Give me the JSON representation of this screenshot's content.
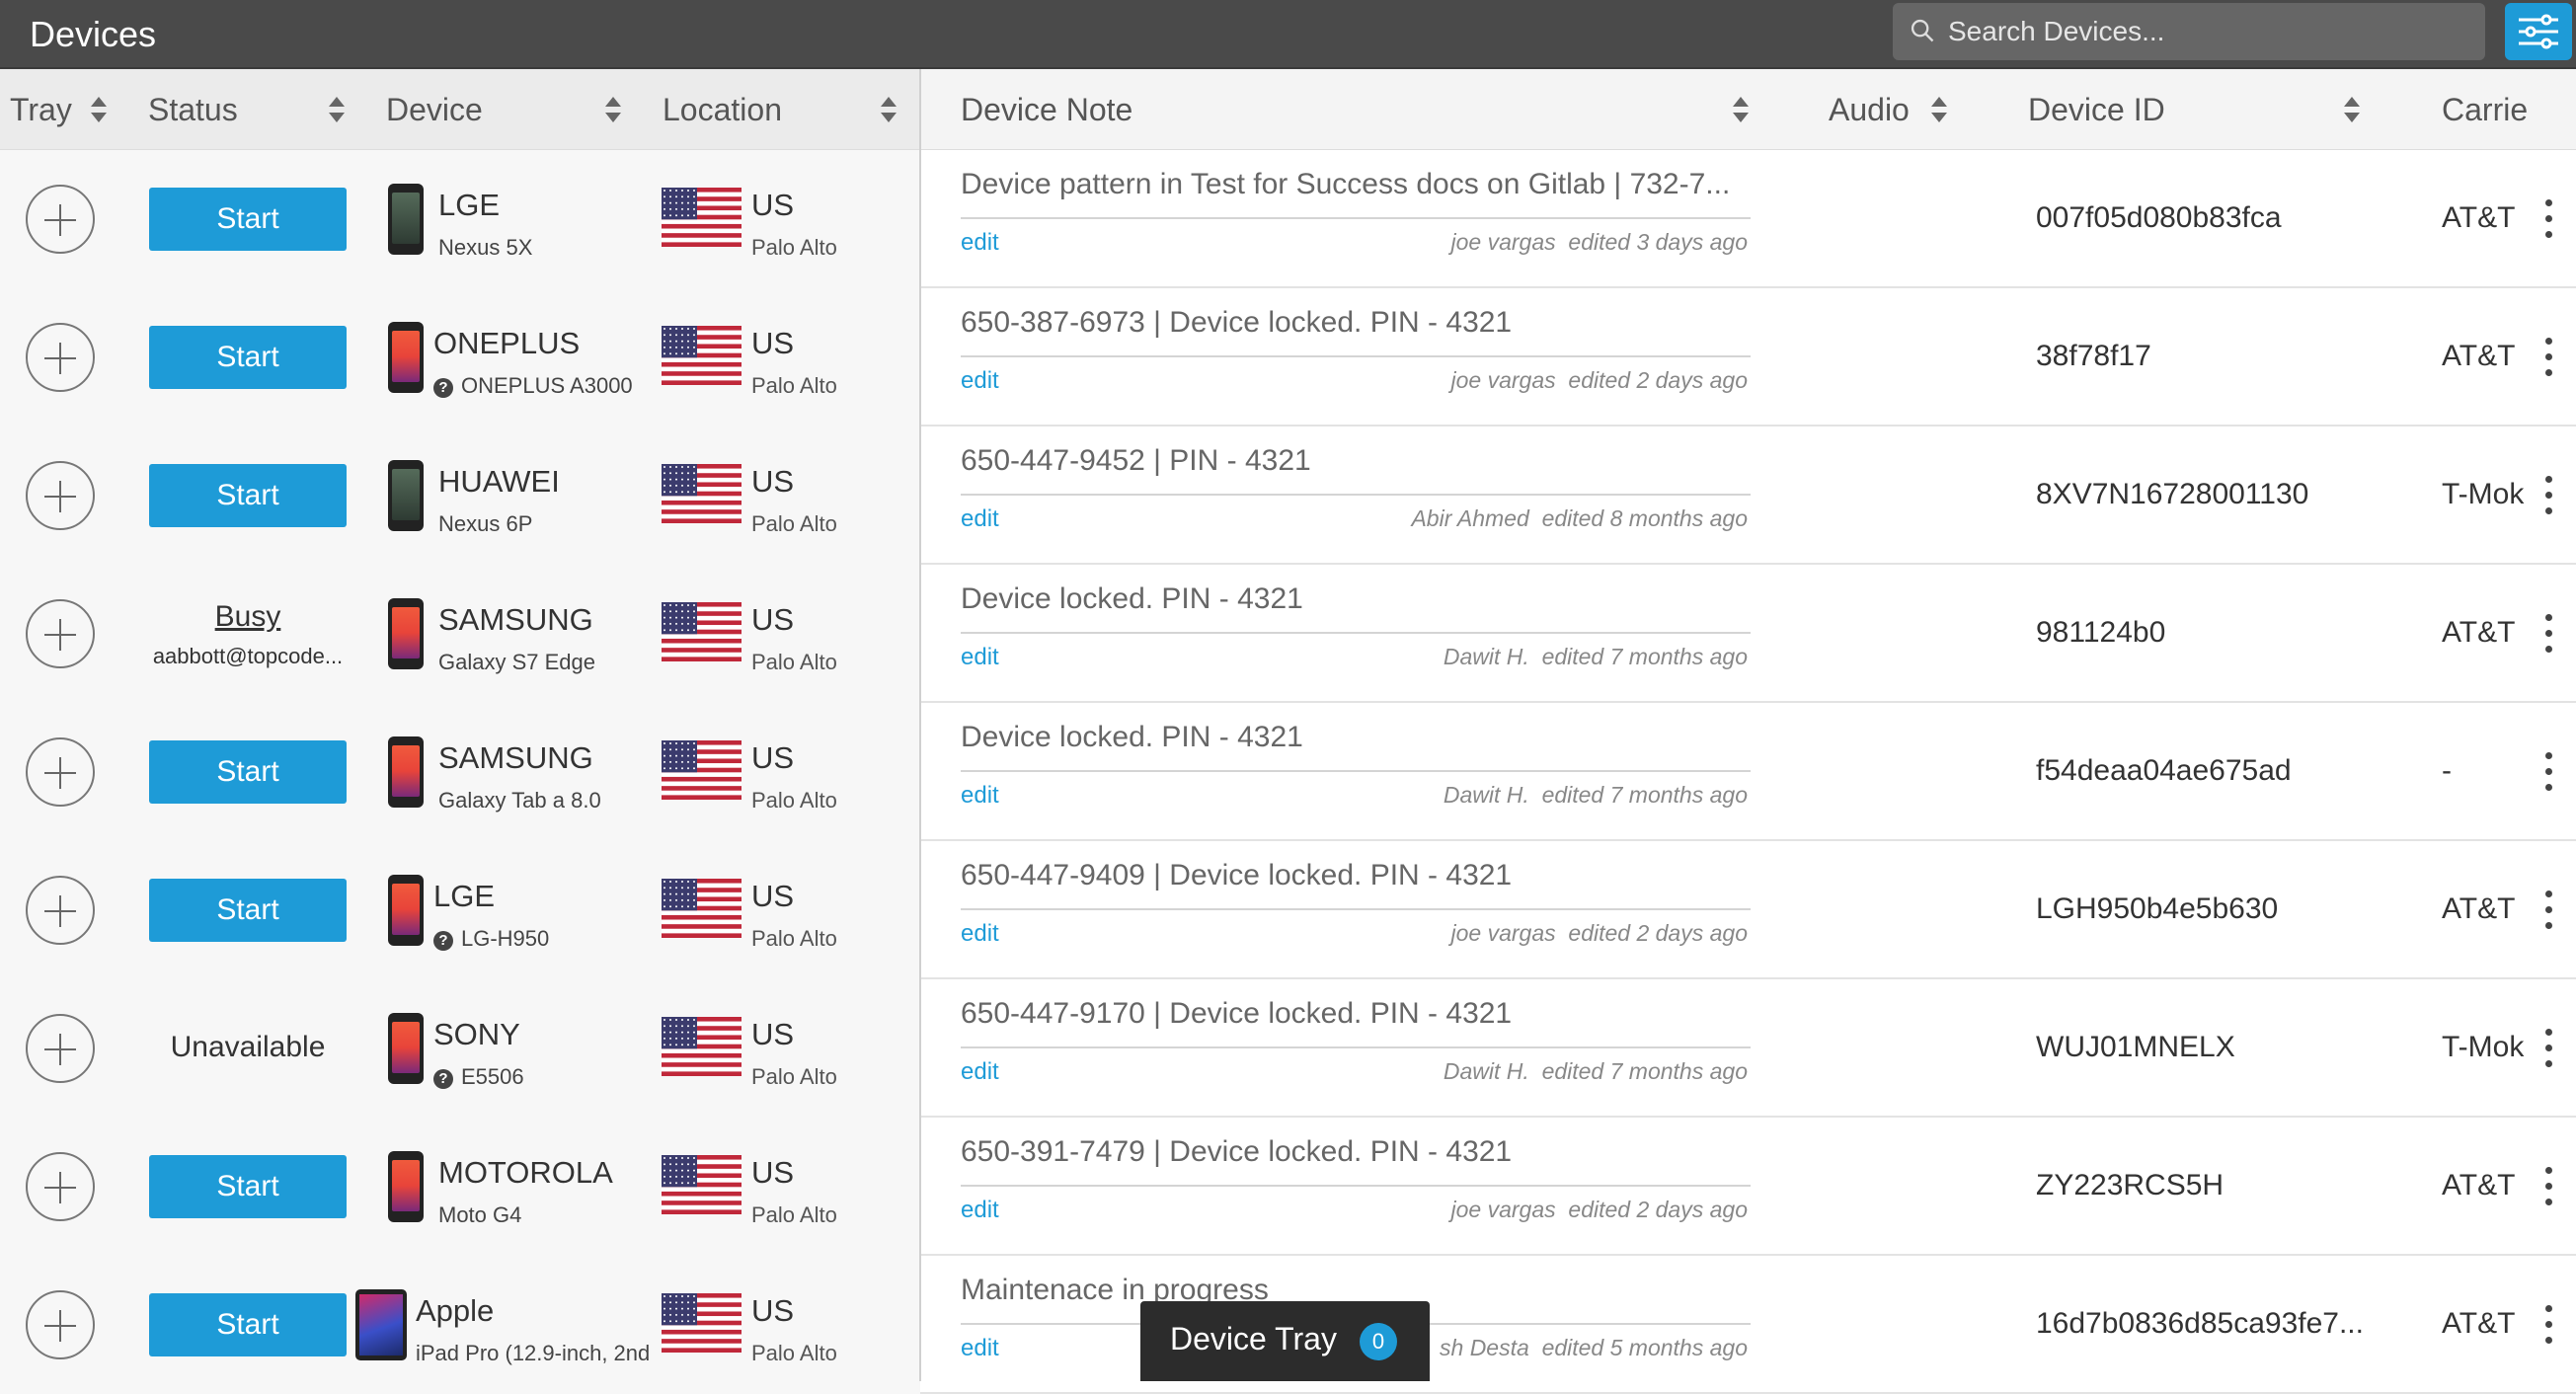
{
  "app": {
    "title": "Devices",
    "search_placeholder": "Search Devices...",
    "accent_color": "#1e9bd7"
  },
  "columns": {
    "tray": "Tray",
    "status": "Status",
    "device": "Device",
    "location": "Location",
    "note": "Device Note",
    "audio": "Audio",
    "device_id": "Device ID",
    "carrier": "Carrie"
  },
  "rows": [
    {
      "status": "Start",
      "status_type": "button",
      "brand": "LGE",
      "model": "Nexus 5X",
      "model_help": false,
      "icon": "phone-dark",
      "country": "US",
      "city": "Palo Alto",
      "note": "Device pattern in Test for Success docs on Gitlab | 732-7...",
      "editor": "joe vargas",
      "edited": "edited 3 days ago",
      "edit_label": "edit",
      "device_id": "007f05d080b83fca",
      "carrier": "AT&T"
    },
    {
      "status": "Start",
      "status_type": "button",
      "brand": "ONEPLUS",
      "model": "ONEPLUS A3000",
      "model_help": true,
      "icon": "phone-color",
      "country": "US",
      "city": "Palo Alto",
      "note": "650-387-6973 | Device locked. PIN - 4321",
      "editor": "joe vargas",
      "edited": "edited 2 days ago",
      "edit_label": "edit",
      "device_id": "38f78f17",
      "carrier": "AT&T"
    },
    {
      "status": "Start",
      "status_type": "button",
      "brand": "HUAWEI",
      "model": "Nexus 6P",
      "model_help": false,
      "icon": "phone-dark",
      "country": "US",
      "city": "Palo Alto",
      "note": "650-447-9452 | PIN - 4321",
      "editor": "Abir Ahmed",
      "edited": "edited 8 months ago",
      "edit_label": "edit",
      "device_id": "8XV7N16728001130",
      "carrier": "T-Mok"
    },
    {
      "status": "Busy",
      "status_type": "busy",
      "busy_user": "aabbott@topcode...",
      "brand": "SAMSUNG",
      "model": "Galaxy S7 Edge",
      "model_help": false,
      "icon": "phone-color",
      "country": "US",
      "city": "Palo Alto",
      "note": "Device locked. PIN - 4321",
      "editor": "Dawit H.",
      "edited": "edited 7 months ago",
      "edit_label": "edit",
      "device_id": "981124b0",
      "carrier": "AT&T"
    },
    {
      "status": "Start",
      "status_type": "button",
      "brand": "SAMSUNG",
      "model": "Galaxy Tab a 8.0",
      "model_help": false,
      "icon": "phone-color",
      "country": "US",
      "city": "Palo Alto",
      "note": "Device locked. PIN - 4321",
      "editor": "Dawit H.",
      "edited": "edited 7 months ago",
      "edit_label": "edit",
      "device_id": "f54deaa04ae675ad",
      "carrier": "-"
    },
    {
      "status": "Start",
      "status_type": "button",
      "brand": "LGE",
      "model": "LG-H950",
      "model_help": true,
      "icon": "phone-color",
      "country": "US",
      "city": "Palo Alto",
      "note": "650-447-9409 | Device locked. PIN - 4321",
      "editor": "joe vargas",
      "edited": "edited 2 days ago",
      "edit_label": "edit",
      "device_id": "LGH950b4e5b630",
      "carrier": "AT&T"
    },
    {
      "status": "Unavailable",
      "status_type": "text",
      "brand": "SONY",
      "model": "E5506",
      "model_help": true,
      "icon": "phone-color",
      "country": "US",
      "city": "Palo Alto",
      "note": "650-447-9170 | Device locked. PIN - 4321",
      "editor": "Dawit H.",
      "edited": "edited 7 months ago",
      "edit_label": "edit",
      "device_id": "WUJ01MNELX",
      "carrier": "T-Mok"
    },
    {
      "status": "Start",
      "status_type": "button",
      "brand": "MOTOROLA",
      "model": "Moto G4",
      "model_help": false,
      "icon": "phone-color",
      "country": "US",
      "city": "Palo Alto",
      "note": "650-391-7479 | Device locked. PIN - 4321",
      "editor": "joe vargas",
      "edited": "edited 2 days ago",
      "edit_label": "edit",
      "device_id": "ZY223RCS5H",
      "carrier": "AT&T"
    },
    {
      "status": "Start",
      "status_type": "button",
      "brand": "Apple",
      "model": "iPad Pro (12.9-inch, 2nd",
      "model_help": false,
      "icon": "tablet",
      "country": "US",
      "city": "Palo Alto",
      "note": "Maintenace in progress",
      "editor": "sh Desta",
      "edited": "edited 5 months ago",
      "edit_label": "edit",
      "device_id": "16d7b0836d85ca93fe7...",
      "carrier": "AT&T"
    }
  ],
  "tray_popup": {
    "label": "Device Tray",
    "count": "0"
  }
}
